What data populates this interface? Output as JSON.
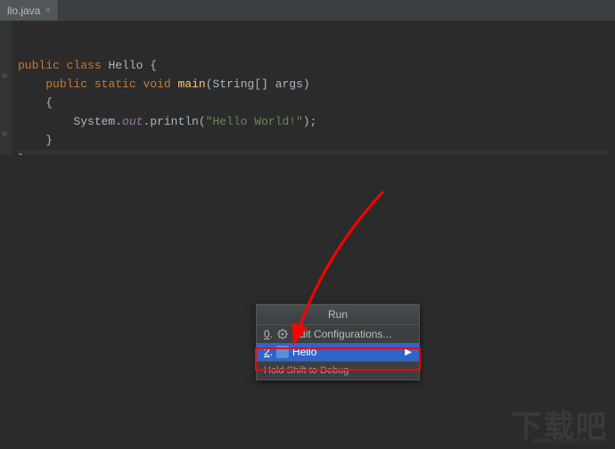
{
  "tab": {
    "label": "llo.java"
  },
  "code": {
    "line1": {
      "kw1": "public",
      "kw2": "class",
      "name": "Hello",
      "open": "{"
    },
    "line2": {
      "kw1": "public",
      "kw2": "static",
      "kw3": "void",
      "method": "main",
      "params": "(String[] args)"
    },
    "line3": "{",
    "line4": {
      "obj": "System.",
      "field": "out",
      "call": ".println(",
      "str": "\"Hello World!\"",
      "end": ");"
    },
    "line5": "}",
    "line6": "}"
  },
  "menu": {
    "title": "Run",
    "items": [
      {
        "key": "0",
        "label": "Edit Configurations..."
      },
      {
        "key": "2",
        "label": "Hello"
      }
    ],
    "hint": "Hold Shift to Debug"
  },
  "watermark": {
    "text": "下载吧",
    "sub": "www.xiazaiba.com"
  }
}
